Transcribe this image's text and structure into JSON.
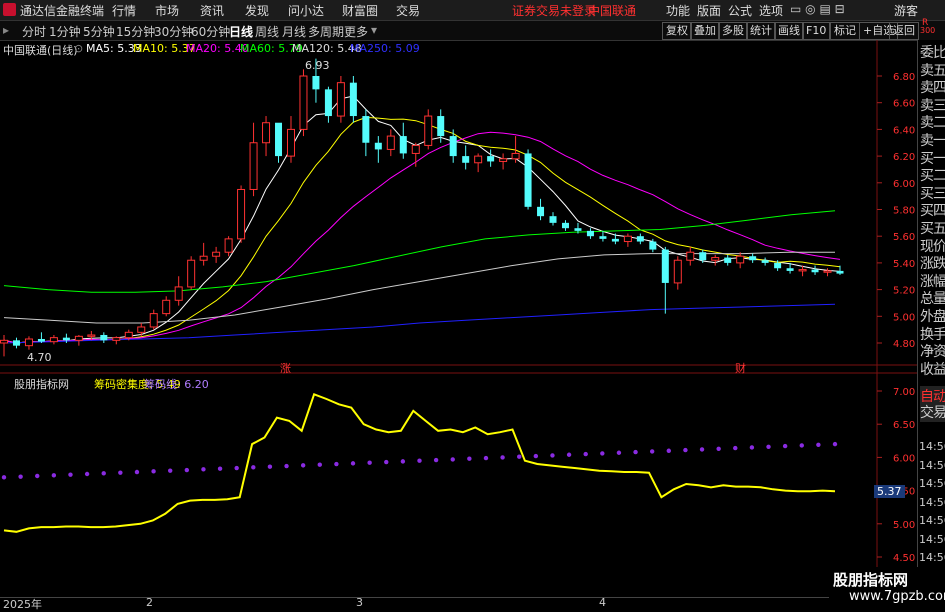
{
  "title_bar": {
    "app_name": "通达信金融终端",
    "menus": [
      "行情",
      "市场",
      "资讯",
      "发现",
      "问小达",
      "财富圈",
      "交易"
    ],
    "login_status": "证券交易未登录",
    "stock_name": "中国联通",
    "right_menus": [
      "功能",
      "版面",
      "公式",
      "选项"
    ],
    "guest": "游客"
  },
  "period_bar": {
    "periods": [
      "分时",
      "1分钟",
      "5分钟",
      "15分钟",
      "30分钟",
      "60分钟",
      "日线",
      "周线",
      "月线",
      "多周期",
      "更多"
    ],
    "active_period": "日线",
    "tools": [
      "复权",
      "叠加",
      "多股",
      "统计",
      "画线",
      "F10",
      "标记",
      "+自选",
      "返回"
    ]
  },
  "main_chart": {
    "header": {
      "stock": "中国联通(日线)",
      "ma5": "MA5: 5.33",
      "ma10": "MA10: 5.37",
      "ma20": "MA20: 5.40",
      "ma60": "MA60: 5.79",
      "ma120": "MA120: 5.48",
      "ma250": "MA250: 5.09"
    },
    "y_ticks": [
      "6.80",
      "6.60",
      "6.40",
      "6.20",
      "6.00",
      "5.80",
      "5.60",
      "5.40",
      "5.20",
      "5.00",
      "4.80"
    ],
    "y_range": [
      4.7,
      6.93
    ],
    "high_label": "6.93",
    "low_label": "4.70",
    "markers": [
      "涨",
      "财"
    ],
    "colors": {
      "up": "#ff3232",
      "down": "#54fcfc",
      "ma5": "#ffffff",
      "ma10": "#ffff00",
      "ma20": "#ff00ff",
      "ma60": "#00ff00",
      "ma120": "#cccccc",
      "ma250": "#2020ff"
    }
  },
  "sub_chart": {
    "header": {
      "name": "股朋指标网",
      "series1": "筹码密集度: 5.49",
      "series2": "筹码线: 6.20"
    },
    "y_ticks": [
      "7.00",
      "6.50",
      "6.00",
      "5.50",
      "5.00",
      "4.50"
    ],
    "y_range": [
      4.5,
      7.0
    ],
    "current_value_label": "5.37",
    "colors": {
      "line": "#ffff00",
      "dots": "#8a2be2"
    }
  },
  "side_panel": {
    "corner_top": "R",
    "corner_bottom": "300",
    "items": [
      "委比",
      "卖五",
      "卖四",
      "卖三",
      "卖二",
      "卖一",
      "买一",
      "买二",
      "买三",
      "买四",
      "买五",
      "现价",
      "涨跌",
      "涨幅",
      "总量",
      "外盘",
      "换手",
      "净资",
      "收益"
    ],
    "bottom_items": [
      "自动",
      "交易"
    ],
    "times": [
      "14:56",
      "14:56",
      "14:56",
      "14:56",
      "14:56",
      "14:56",
      "14:56",
      "14:56"
    ]
  },
  "bottom_bar": {
    "ticks": [
      "2025年",
      "2",
      "3",
      "4"
    ]
  },
  "watermark": {
    "line1": "股朋指标网",
    "line2": "www.7gpzb.com"
  },
  "chart_data": [
    {
      "type": "candlestick",
      "title": "中国联通(日线)",
      "ylim": [
        4.7,
        6.93
      ],
      "candles": [
        [
          4.8,
          4.86,
          4.7,
          4.82
        ],
        [
          4.82,
          4.84,
          4.76,
          4.78
        ],
        [
          4.78,
          4.85,
          4.75,
          4.83
        ],
        [
          4.83,
          4.88,
          4.8,
          4.81
        ],
        [
          4.81,
          4.86,
          4.79,
          4.84
        ],
        [
          4.84,
          4.87,
          4.8,
          4.82
        ],
        [
          4.82,
          4.86,
          4.78,
          4.85
        ],
        [
          4.85,
          4.89,
          4.82,
          4.86
        ],
        [
          4.86,
          4.88,
          4.8,
          4.82
        ],
        [
          4.82,
          4.85,
          4.79,
          4.84
        ],
        [
          4.84,
          4.9,
          4.82,
          4.88
        ],
        [
          4.88,
          4.95,
          4.85,
          4.92
        ],
        [
          4.92,
          5.05,
          4.9,
          5.02
        ],
        [
          5.02,
          5.15,
          5.0,
          5.12
        ],
        [
          5.12,
          5.3,
          5.08,
          5.22
        ],
        [
          5.22,
          5.45,
          5.2,
          5.42
        ],
        [
          5.42,
          5.55,
          5.38,
          5.45
        ],
        [
          5.45,
          5.52,
          5.4,
          5.48
        ],
        [
          5.48,
          5.6,
          5.45,
          5.58
        ],
        [
          5.58,
          5.98,
          5.55,
          5.95
        ],
        [
          5.95,
          6.45,
          5.9,
          6.3
        ],
        [
          6.3,
          6.5,
          6.2,
          6.45
        ],
        [
          6.45,
          6.4,
          6.15,
          6.2
        ],
        [
          6.2,
          6.5,
          6.15,
          6.4
        ],
        [
          6.4,
          6.85,
          6.35,
          6.8
        ],
        [
          6.8,
          6.93,
          6.6,
          6.7
        ],
        [
          6.7,
          6.72,
          6.45,
          6.5
        ],
        [
          6.5,
          6.8,
          6.45,
          6.75
        ],
        [
          6.75,
          6.8,
          6.45,
          6.5
        ],
        [
          6.5,
          6.55,
          6.2,
          6.3
        ],
        [
          6.3,
          6.35,
          6.15,
          6.25
        ],
        [
          6.25,
          6.4,
          6.2,
          6.35
        ],
        [
          6.35,
          6.45,
          6.18,
          6.22
        ],
        [
          6.22,
          6.3,
          6.12,
          6.28
        ],
        [
          6.28,
          6.55,
          6.25,
          6.5
        ],
        [
          6.5,
          6.55,
          6.3,
          6.35
        ],
        [
          6.35,
          6.4,
          6.15,
          6.2
        ],
        [
          6.2,
          6.28,
          6.1,
          6.15
        ],
        [
          6.15,
          6.22,
          6.08,
          6.2
        ],
        [
          6.2,
          6.25,
          6.12,
          6.16
        ],
        [
          6.16,
          6.22,
          6.1,
          6.18
        ],
        [
          6.18,
          6.35,
          6.15,
          6.22
        ],
        [
          6.22,
          6.25,
          5.8,
          5.82
        ],
        [
          5.82,
          5.88,
          5.72,
          5.75
        ],
        [
          5.75,
          5.78,
          5.68,
          5.7
        ],
        [
          5.7,
          5.72,
          5.64,
          5.66
        ],
        [
          5.66,
          5.7,
          5.62,
          5.64
        ],
        [
          5.64,
          5.66,
          5.58,
          5.6
        ],
        [
          5.6,
          5.64,
          5.56,
          5.58
        ],
        [
          5.58,
          5.62,
          5.54,
          5.56
        ],
        [
          5.56,
          5.62,
          5.52,
          5.6
        ],
        [
          5.6,
          5.62,
          5.54,
          5.56
        ],
        [
          5.56,
          5.58,
          5.48,
          5.5
        ],
        [
          5.5,
          5.52,
          5.02,
          5.25
        ],
        [
          5.25,
          5.45,
          5.2,
          5.42
        ],
        [
          5.42,
          5.52,
          5.38,
          5.48
        ],
        [
          5.48,
          5.5,
          5.4,
          5.42
        ],
        [
          5.42,
          5.46,
          5.38,
          5.44
        ],
        [
          5.44,
          5.46,
          5.38,
          5.4
        ],
        [
          5.4,
          5.48,
          5.36,
          5.45
        ],
        [
          5.45,
          5.47,
          5.4,
          5.42
        ],
        [
          5.42,
          5.44,
          5.38,
          5.4
        ],
        [
          5.4,
          5.42,
          5.34,
          5.36
        ],
        [
          5.36,
          5.4,
          5.32,
          5.34
        ],
        [
          5.34,
          5.38,
          5.3,
          5.35
        ],
        [
          5.35,
          5.38,
          5.31,
          5.33
        ],
        [
          5.33,
          5.36,
          5.3,
          5.34
        ],
        [
          5.34,
          5.38,
          5.31,
          5.32
        ]
      ],
      "series": [
        {
          "name": "MA250",
          "values": [
            4.8,
            4.81,
            4.82,
            4.83,
            4.84,
            4.86,
            4.88,
            4.9,
            4.92,
            4.95,
            4.97,
            4.99,
            5.01,
            5.03,
            5.05,
            5.06,
            5.07,
            5.08,
            5.09
          ]
        },
        {
          "name": "MA60",
          "values": [
            5.23,
            5.2,
            5.18,
            5.18,
            5.19,
            5.22,
            5.26,
            5.32,
            5.38,
            5.45,
            5.52,
            5.58,
            5.61,
            5.63,
            5.64,
            5.65,
            5.68,
            5.72,
            5.76,
            5.79
          ]
        },
        {
          "name": "MA120",
          "values": [
            4.99,
            4.97,
            4.95,
            4.95,
            4.97,
            5.01,
            5.07,
            5.13,
            5.2,
            5.26,
            5.32,
            5.38,
            5.43,
            5.46,
            5.47,
            5.47,
            5.47,
            5.48,
            5.48
          ]
        }
      ]
    },
    {
      "type": "line",
      "title": "股朋指标网",
      "ylim": [
        4.5,
        7.0
      ],
      "series": [
        {
          "name": "筹码密集度",
          "values": [
            4.9,
            4.88,
            4.93,
            4.95,
            4.95,
            4.96,
            4.96,
            4.95,
            4.95,
            4.96,
            4.98,
            5.0,
            5.05,
            5.15,
            5.3,
            5.35,
            5.36,
            5.36,
            5.37,
            5.4,
            6.2,
            6.3,
            6.6,
            6.55,
            6.4,
            6.95,
            6.88,
            6.8,
            6.75,
            6.5,
            6.42,
            6.38,
            6.4,
            6.7,
            6.55,
            6.4,
            6.42,
            6.38,
            6.45,
            6.35,
            6.38,
            6.42,
            5.95,
            5.9,
            5.88,
            5.86,
            5.84,
            5.82,
            5.8,
            5.79,
            5.78,
            5.78,
            5.77,
            5.4,
            5.52,
            5.6,
            5.58,
            5.55,
            5.58,
            5.56,
            5.56,
            5.55,
            5.52,
            5.5,
            5.49,
            5.49,
            5.5,
            5.49
          ]
        },
        {
          "name": "筹码线",
          "values": [
            5.7,
            5.71,
            5.72,
            5.73,
            5.74,
            5.75,
            5.76,
            5.77,
            5.78,
            5.79,
            5.8,
            5.81,
            5.82,
            5.83,
            5.84,
            5.85,
            5.86,
            5.87,
            5.88,
            5.89,
            5.9,
            5.91,
            5.92,
            5.93,
            5.94,
            5.95,
            5.96,
            5.97,
            5.98,
            5.99,
            6.0,
            6.01,
            6.02,
            6.03,
            6.04,
            6.05,
            6.06,
            6.07,
            6.08,
            6.09,
            6.1,
            6.11,
            6.12,
            6.13,
            6.14,
            6.15,
            6.16,
            6.17,
            6.18,
            6.19,
            6.2
          ]
        }
      ]
    }
  ]
}
